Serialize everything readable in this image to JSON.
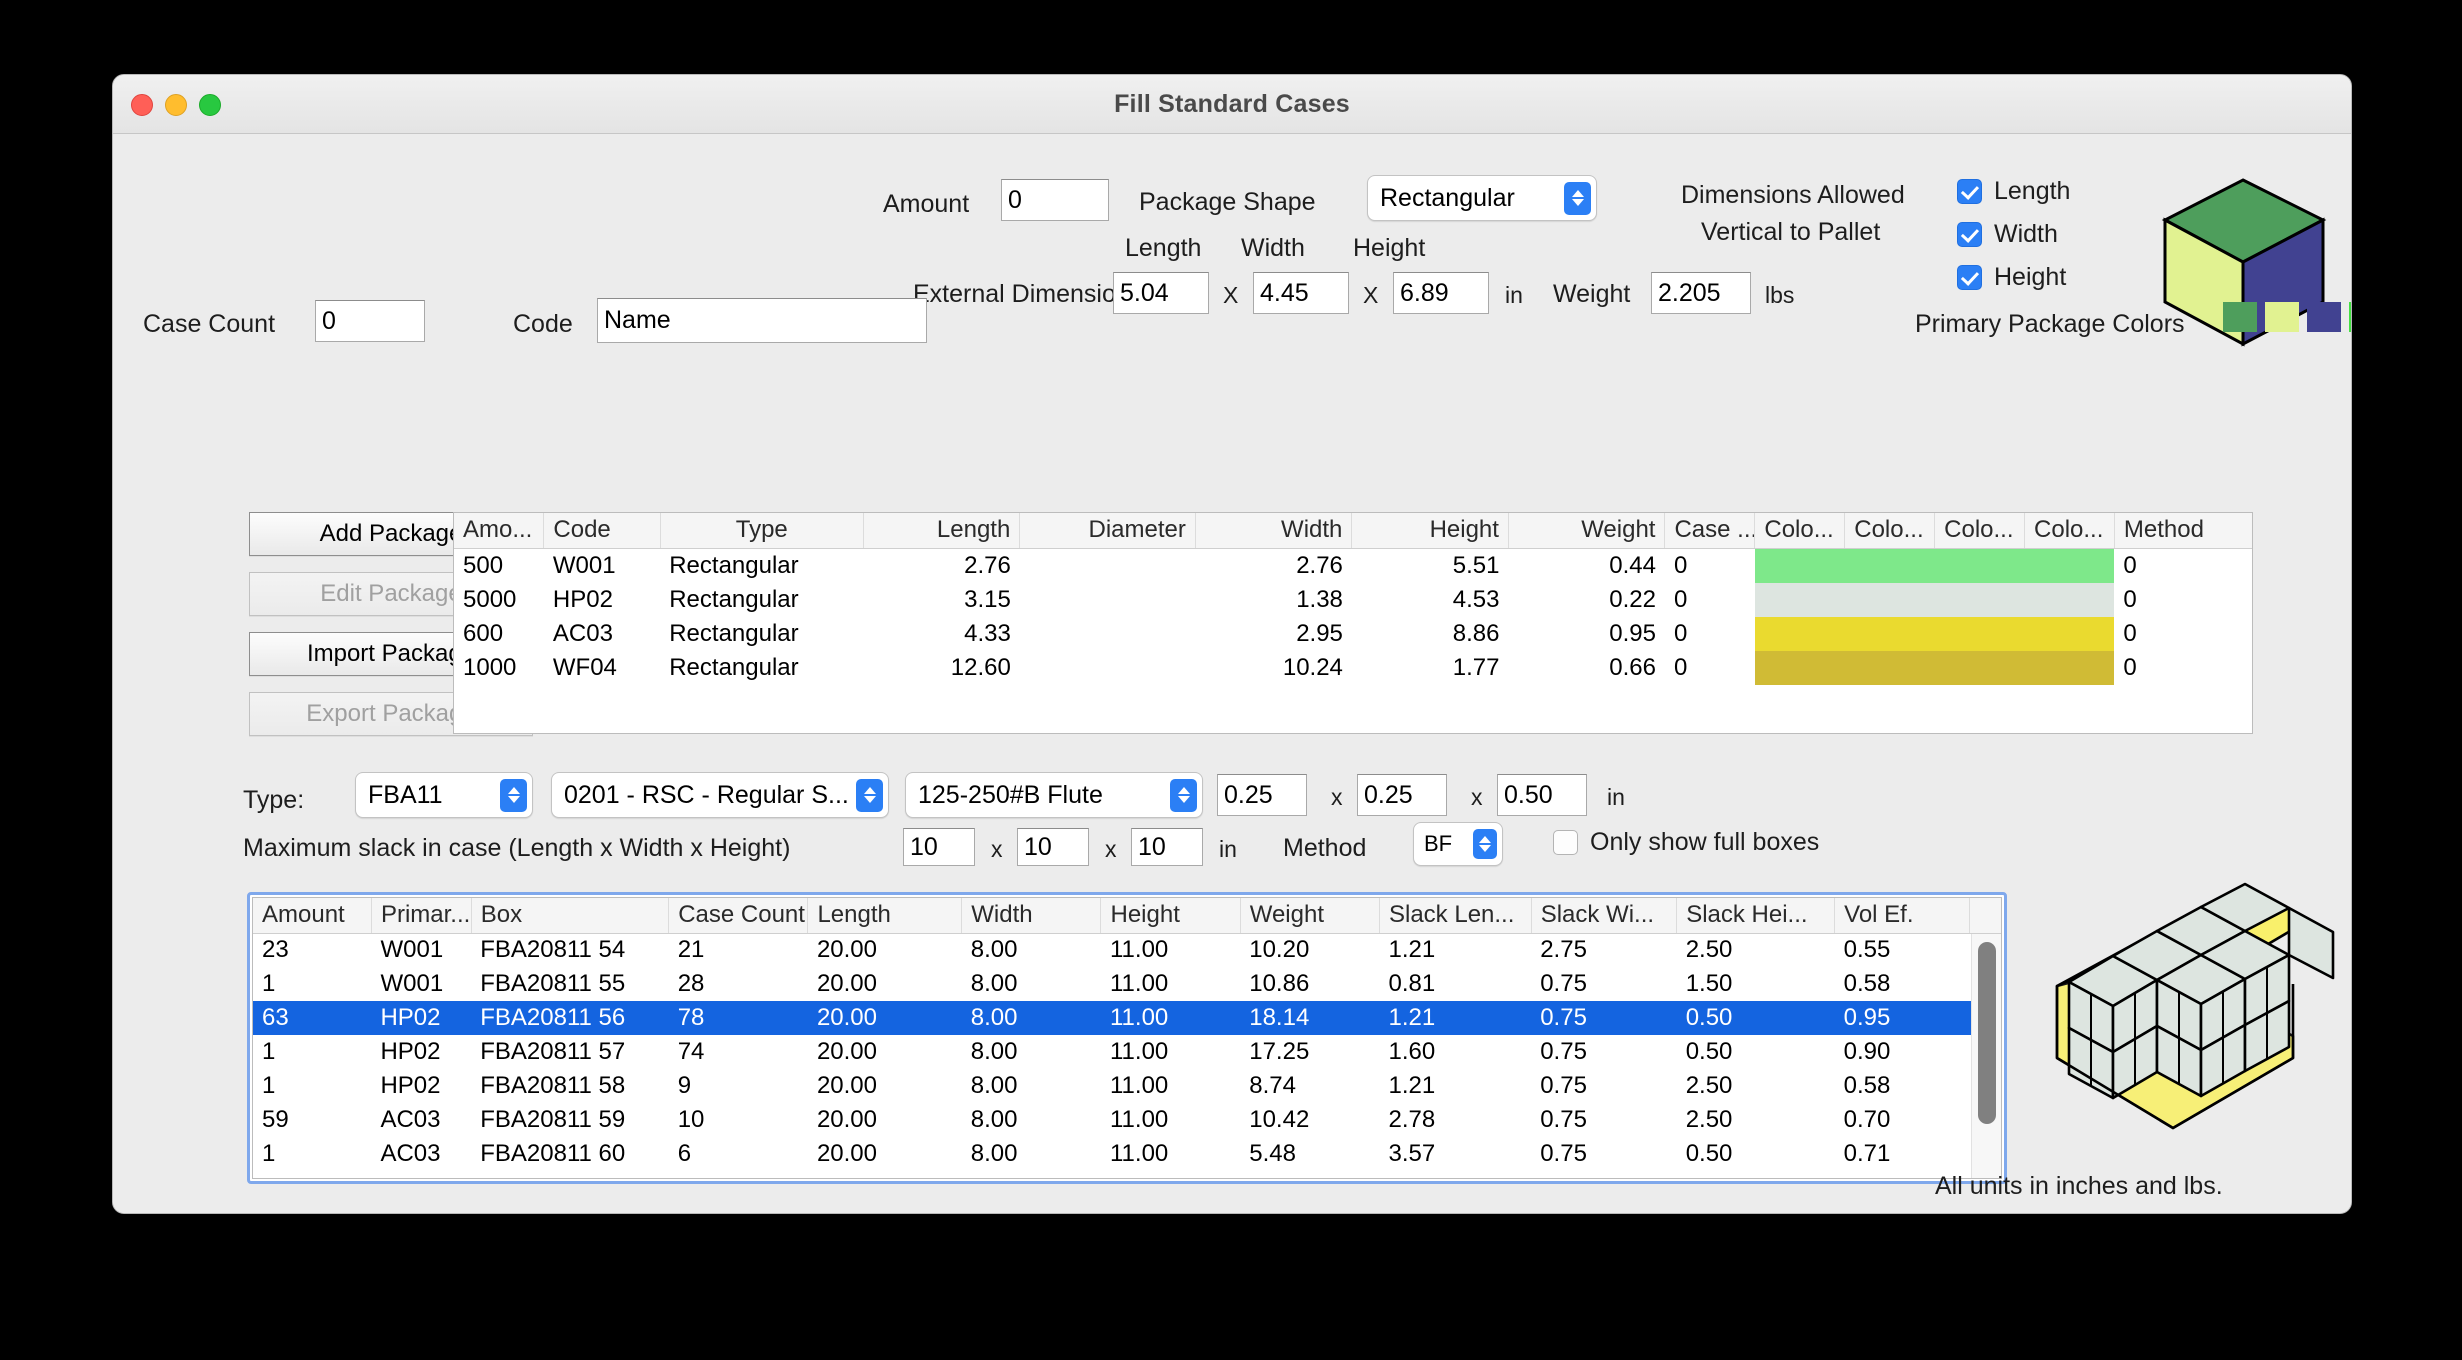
{
  "window": {
    "title": "Fill Standard Cases",
    "traffic_lights": [
      "close",
      "minimize",
      "maximize"
    ]
  },
  "top_form": {
    "amount_label": "Amount",
    "amount_value": "0",
    "package_shape_label": "Package Shape",
    "package_shape_value": "Rectangular",
    "length_label": "Length",
    "width_label": "Width",
    "height_label": "Height",
    "external_dimensions_label": "External Dimensions",
    "length_value": "5.04",
    "width_value": "4.45",
    "height_value": "6.89",
    "x_sep": "X",
    "unit_in": "in",
    "weight_label": "Weight",
    "weight_value": "2.205",
    "unit_lbs": "lbs",
    "dims_allowed_line1": "Dimensions Allowed",
    "dims_allowed_line2": "Vertical to Pallet",
    "checkboxes": [
      {
        "label": "Length",
        "checked": true
      },
      {
        "label": "Width",
        "checked": true
      },
      {
        "label": "Height",
        "checked": true
      }
    ]
  },
  "case_row": {
    "case_count_label": "Case Count",
    "case_count_value": "0",
    "code_label": "Code",
    "name_value": "Name",
    "primary_colors_label": "Primary Package Colors",
    "primary_colors": [
      "#4e9e5c",
      "#e1f291",
      "#414291",
      "#45e044"
    ]
  },
  "buttons": [
    {
      "label": "Add Package",
      "enabled": true
    },
    {
      "label": "Edit Package",
      "enabled": false
    },
    {
      "label": "Import Package",
      "enabled": true
    },
    {
      "label": "Export Package",
      "enabled": false
    }
  ],
  "package_table": {
    "columns": [
      "Amo...",
      "Code",
      "Type",
      "Length",
      "Diameter",
      "Width",
      "Height",
      "Weight",
      "Case ...",
      "Colo...",
      "Colo...",
      "Colo...",
      "Colo...",
      "Method"
    ],
    "rows": [
      {
        "amount": "500",
        "code": "W001",
        "type": "Rectangular",
        "length": "2.76",
        "diameter": "",
        "width": "2.76",
        "height": "5.51",
        "weight": "0.44",
        "case": "0",
        "color": "#7ee88a",
        "method": "0"
      },
      {
        "amount": "5000",
        "code": "HP02",
        "type": "Rectangular",
        "length": "3.15",
        "diameter": "",
        "width": "1.38",
        "height": "4.53",
        "weight": "0.22",
        "case": "0",
        "color": "#dde5e0",
        "method": "0"
      },
      {
        "amount": "600",
        "code": "AC03",
        "type": "Rectangular",
        "length": "4.33",
        "diameter": "",
        "width": "2.95",
        "height": "8.86",
        "weight": "0.95",
        "case": "0",
        "color": "#eada2f",
        "method": "0"
      },
      {
        "amount": "1000",
        "code": "WF04",
        "type": "Rectangular",
        "length": "12.60",
        "diameter": "",
        "width": "10.24",
        "height": "1.77",
        "weight": "0.66",
        "case": "0",
        "color": "#d0bb35",
        "method": "0"
      }
    ]
  },
  "type_row": {
    "type_label": "Type:",
    "box_type_value": "FBA11",
    "style_value": "0201 - RSC - Regular S...",
    "flute_value": "125-250#B Flute",
    "thickness_length": "0.25",
    "thickness_width": "0.25",
    "thickness_height": "0.50",
    "x_sep": "x",
    "unit_in": "in"
  },
  "slack_row": {
    "label": "Maximum slack in case  (Length x Width x Height)",
    "length": "10",
    "width": "10",
    "height": "10",
    "unit_in": "in",
    "method_label": "Method",
    "method_value": "BF",
    "x_sep": "x",
    "only_full_boxes_label": "Only show full boxes",
    "only_full_boxes_checked": false
  },
  "results_table": {
    "columns": [
      "Amount",
      "Primar...",
      "Box",
      "Case Count",
      "Length",
      "Width",
      "Height",
      "Weight",
      "Slack Len...",
      "Slack Wi...",
      "Slack Hei...",
      "Vol Ef."
    ],
    "rows": [
      {
        "amount": "23",
        "primary": "W001",
        "box": "FBA20811 54",
        "case_count": "21",
        "length": "20.00",
        "width": "8.00",
        "height": "11.00",
        "weight": "10.20",
        "slack_len": "1.21",
        "slack_wid": "2.75",
        "slack_hei": "2.50",
        "vol_ef": "0.55",
        "selected": false
      },
      {
        "amount": "1",
        "primary": "W001",
        "box": "FBA20811 55",
        "case_count": "28",
        "length": "20.00",
        "width": "8.00",
        "height": "11.00",
        "weight": "10.86",
        "slack_len": "0.81",
        "slack_wid": "0.75",
        "slack_hei": "1.50",
        "vol_ef": "0.58",
        "selected": false
      },
      {
        "amount": "63",
        "primary": "HP02",
        "box": "FBA20811 56",
        "case_count": "78",
        "length": "20.00",
        "width": "8.00",
        "height": "11.00",
        "weight": "18.14",
        "slack_len": "1.21",
        "slack_wid": "0.75",
        "slack_hei": "0.50",
        "vol_ef": "0.95",
        "selected": true
      },
      {
        "amount": "1",
        "primary": "HP02",
        "box": "FBA20811 57",
        "case_count": "74",
        "length": "20.00",
        "width": "8.00",
        "height": "11.00",
        "weight": "17.25",
        "slack_len": "1.60",
        "slack_wid": "0.75",
        "slack_hei": "0.50",
        "vol_ef": "0.90",
        "selected": false
      },
      {
        "amount": "1",
        "primary": "HP02",
        "box": "FBA20811 58",
        "case_count": "9",
        "length": "20.00",
        "width": "8.00",
        "height": "11.00",
        "weight": "8.74",
        "slack_len": "1.21",
        "slack_wid": "0.75",
        "slack_hei": "2.50",
        "vol_ef": "0.58",
        "selected": false
      },
      {
        "amount": "59",
        "primary": "AC03",
        "box": "FBA20811 59",
        "case_count": "10",
        "length": "20.00",
        "width": "8.00",
        "height": "11.00",
        "weight": "10.42",
        "slack_len": "2.78",
        "slack_wid": "0.75",
        "slack_hei": "2.50",
        "vol_ef": "0.70",
        "selected": false
      },
      {
        "amount": "1",
        "primary": "AC03",
        "box": "FBA20811 60",
        "case_count": "6",
        "length": "20.00",
        "width": "8.00",
        "height": "11.00",
        "weight": "5.48",
        "slack_len": "3.57",
        "slack_wid": "0.75",
        "slack_hei": "0.50",
        "vol_ef": "0.71",
        "selected": false
      }
    ]
  },
  "footer": {
    "caption": "All units in inches and lbs."
  },
  "illustrations": {
    "package_preview": {
      "top_color": "#4e9e5c",
      "left_color": "#e1f291",
      "right_color": "#414291"
    },
    "case_preview": {
      "flap_color": "#f9f06b",
      "package_color": "#dde5e0"
    }
  }
}
